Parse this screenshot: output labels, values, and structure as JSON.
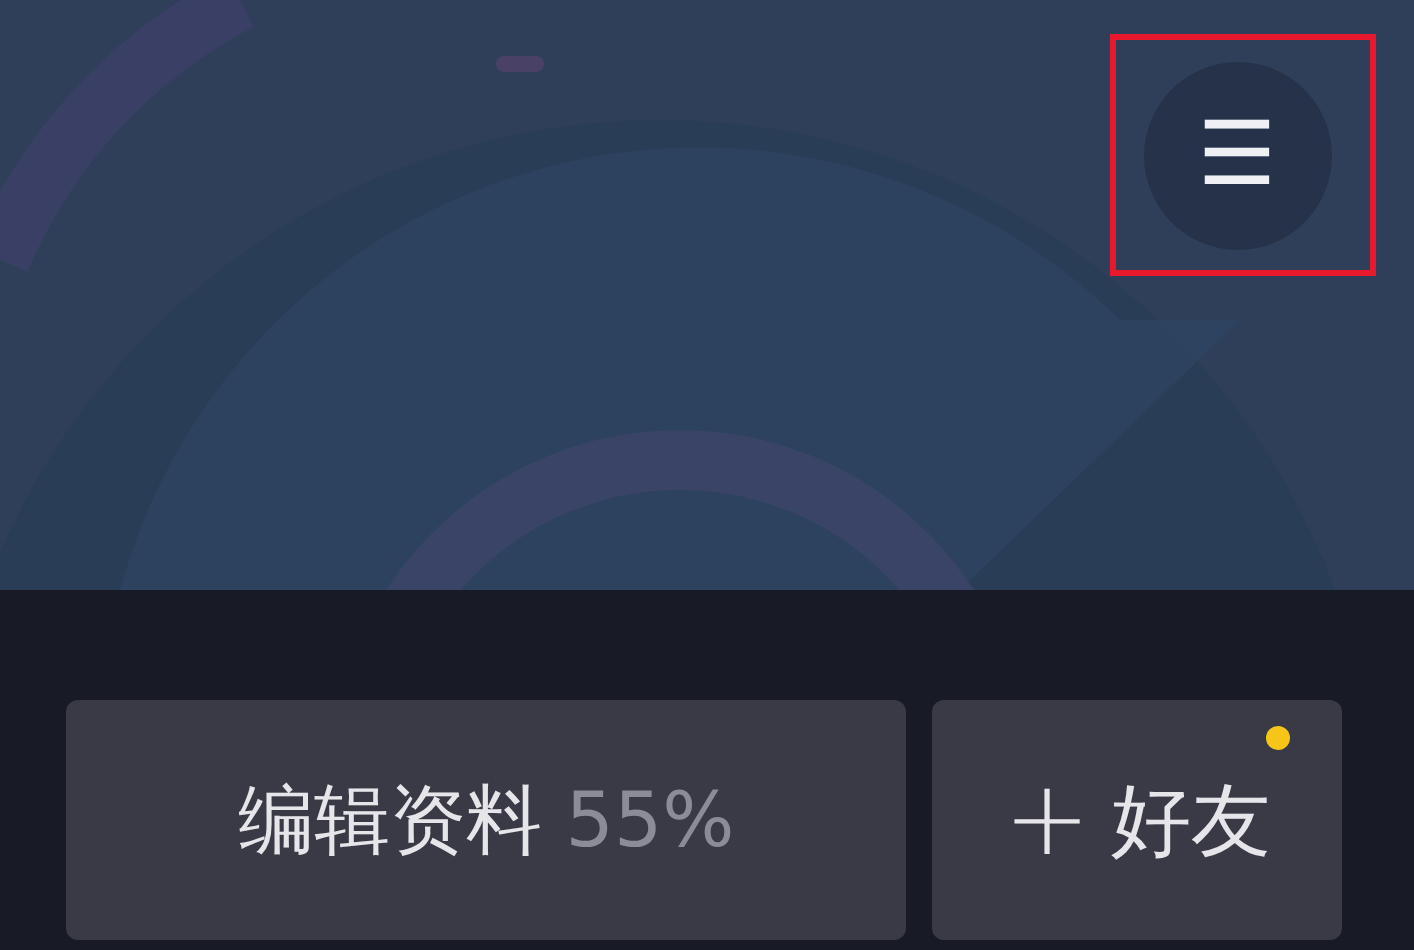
{
  "header": {
    "menu_button": {
      "icon": "☰"
    }
  },
  "actions": {
    "edit_profile": {
      "label": "编辑资料",
      "progress": "55%"
    },
    "add_friend": {
      "icon": "+",
      "label": "好友",
      "notification_dot": true
    }
  }
}
